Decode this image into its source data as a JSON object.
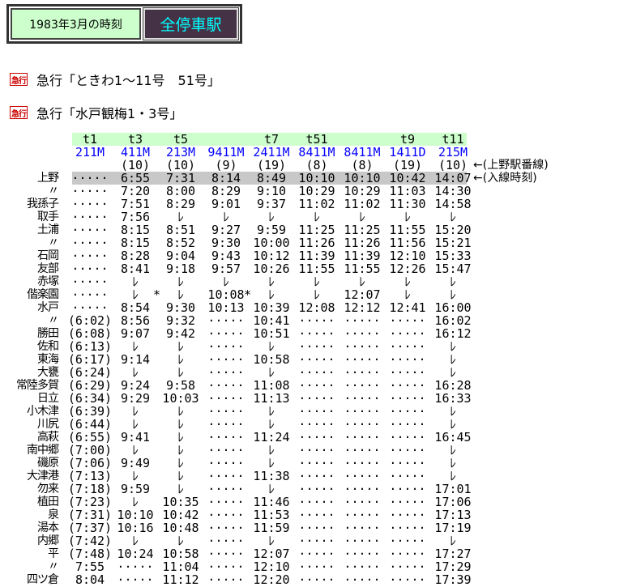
{
  "header": {
    "period": "1983年3月の時刻",
    "mode": "全停車駅"
  },
  "trains": [
    {
      "badge": "急行",
      "name": "急行「ときわ1～11号　51号」"
    },
    {
      "badge": "急行",
      "name": "急行「水戸観梅1・3号」"
    }
  ],
  "table": {
    "trip_codes": [
      "t1",
      "t3",
      "t5",
      "",
      "t7",
      "t51",
      "",
      "t9",
      "t11"
    ],
    "train_numbers": [
      "211M",
      "411M",
      "213M",
      "9411M",
      "2411M",
      "8411M",
      "8411M",
      "1411D",
      "215M"
    ],
    "platforms": [
      "",
      "(10)",
      "(10)",
      "(9)",
      "(19)",
      "(8)",
      "(8)",
      "(19)",
      "(10)"
    ],
    "platform_note": "←(上野駅番線)",
    "entry_note": "←(入線時刻)",
    "rows": [
      {
        "station": "上野",
        "times": [
          "·····",
          "6:55",
          "7:31",
          "8:14",
          "8:49",
          "10:10",
          "10:10",
          "10:42",
          "14:07"
        ],
        "highlight": true
      },
      {
        "station": "〃",
        "times": [
          "·····",
          "7:20",
          "8:00",
          "8:29",
          "9:10",
          "10:29",
          "10:29",
          "11:03",
          "14:30"
        ]
      },
      {
        "station": "我孫子",
        "times": [
          "·····",
          "7:51",
          "8:29",
          "9:01",
          "9:37",
          "11:02",
          "11:02",
          "11:30",
          "14:58"
        ]
      },
      {
        "station": "取手",
        "times": [
          "·····",
          "7:56",
          "ﾚ",
          "ﾚ",
          "ﾚ",
          "ﾚ",
          "ﾚ",
          "ﾚ",
          "ﾚ"
        ]
      },
      {
        "station": "土浦",
        "times": [
          "·····",
          "8:15",
          "8:51",
          "9:27",
          "9:59",
          "11:25",
          "11:25",
          "11:55",
          "15:20"
        ]
      },
      {
        "station": "〃",
        "times": [
          "·····",
          "8:15",
          "8:52",
          "9:30",
          "10:00",
          "11:26",
          "11:26",
          "11:56",
          "15:21"
        ]
      },
      {
        "station": "石岡",
        "times": [
          "·····",
          "8:28",
          "9:04",
          "9:43",
          "10:12",
          "11:39",
          "11:39",
          "12:10",
          "15:33"
        ]
      },
      {
        "station": "友部",
        "times": [
          "·····",
          "8:41",
          "9:18",
          "9:57",
          "10:26",
          "11:55",
          "11:55",
          "12:26",
          "15:47"
        ]
      },
      {
        "station": "赤塚",
        "times": [
          "·····",
          "ﾚ",
          "ﾚ",
          "ﾚ",
          "ﾚ",
          "ﾚ",
          "ﾚ",
          "ﾚ",
          "ﾚ"
        ]
      },
      {
        "station": "偕楽園",
        "times": [
          "·····",
          "ﾚ",
          "ﾚ",
          "10:08",
          "ﾚ",
          "ﾚ",
          "12:07",
          "ﾚ",
          "ﾚ"
        ],
        "asterisks": [
          2,
          4
        ],
        "asterisk": "*"
      },
      {
        "station": "水戸",
        "times": [
          "·····",
          "8:54",
          "9:30",
          "10:13",
          "10:39",
          "12:08",
          "12:12",
          "12:41",
          "16:00"
        ]
      },
      {
        "station": "〃",
        "times": [
          "(6:02)",
          "8:56",
          "9:32",
          "·····",
          "10:41",
          "·····",
          "·····",
          "·····",
          "16:02"
        ]
      },
      {
        "station": "勝田",
        "times": [
          "(6:08)",
          "9:07",
          "9:42",
          "·····",
          "10:51",
          "·····",
          "·····",
          "·····",
          "16:12"
        ]
      },
      {
        "station": "佐和",
        "times": [
          "(6:13)",
          "ﾚ",
          "ﾚ",
          "·····",
          "ﾚ",
          "·····",
          "·····",
          "·····",
          "ﾚ"
        ]
      },
      {
        "station": "東海",
        "times": [
          "(6:17)",
          "9:14",
          "ﾚ",
          "·····",
          "10:58",
          "·····",
          "·····",
          "·····",
          "ﾚ"
        ]
      },
      {
        "station": "大甕",
        "times": [
          "(6:24)",
          "ﾚ",
          "ﾚ",
          "·····",
          "ﾚ",
          "·····",
          "·····",
          "·····",
          "ﾚ"
        ]
      },
      {
        "station": "常陸多賀",
        "times": [
          "(6:29)",
          "9:24",
          "9:58",
          "·····",
          "11:08",
          "·····",
          "·····",
          "·····",
          "16:28"
        ]
      },
      {
        "station": "日立",
        "times": [
          "(6:34)",
          "9:29",
          "10:03",
          "·····",
          "11:13",
          "·····",
          "·····",
          "·····",
          "16:33"
        ]
      },
      {
        "station": "小木津",
        "times": [
          "(6:39)",
          "ﾚ",
          "ﾚ",
          "·····",
          "ﾚ",
          "·····",
          "·····",
          "·····",
          "ﾚ"
        ]
      },
      {
        "station": "川尻",
        "times": [
          "(6:44)",
          "ﾚ",
          "ﾚ",
          "·····",
          "ﾚ",
          "·····",
          "·····",
          "·····",
          "ﾚ"
        ]
      },
      {
        "station": "高萩",
        "times": [
          "(6:55)",
          "9:41",
          "ﾚ",
          "·····",
          "11:24",
          "·····",
          "·····",
          "·····",
          "16:45"
        ]
      },
      {
        "station": "南中郷",
        "times": [
          "(7:00)",
          "ﾚ",
          "ﾚ",
          "·····",
          "ﾚ",
          "·····",
          "·····",
          "·····",
          "ﾚ"
        ]
      },
      {
        "station": "磯原",
        "times": [
          "(7:06)",
          "9:49",
          "ﾚ",
          "·····",
          "ﾚ",
          "·····",
          "·····",
          "·····",
          "ﾚ"
        ]
      },
      {
        "station": "大津港",
        "times": [
          "(7:13)",
          "ﾚ",
          "ﾚ",
          "·····",
          "11:38",
          "·····",
          "·····",
          "·····",
          "ﾚ"
        ]
      },
      {
        "station": "勿来",
        "times": [
          "(7:18)",
          "9:59",
          "ﾚ",
          "·····",
          "ﾚ",
          "·····",
          "·····",
          "·····",
          "17:01"
        ]
      },
      {
        "station": "植田",
        "times": [
          "(7:23)",
          "ﾚ",
          "10:35",
          "·····",
          "11:46",
          "·····",
          "·····",
          "·····",
          "17:06"
        ]
      },
      {
        "station": "泉",
        "times": [
          "(7:31)",
          "10:10",
          "10:42",
          "·····",
          "11:53",
          "·····",
          "·····",
          "·····",
          "17:13"
        ]
      },
      {
        "station": "湯本",
        "times": [
          "(7:37)",
          "10:16",
          "10:48",
          "·····",
          "11:59",
          "·····",
          "·····",
          "·····",
          "17:19"
        ]
      },
      {
        "station": "内郷",
        "times": [
          "(7:42)",
          "ﾚ",
          "ﾚ",
          "·····",
          "ﾚ",
          "·····",
          "·····",
          "·····",
          "ﾚ"
        ]
      },
      {
        "station": "平",
        "times": [
          "(7:48)",
          "10:24",
          "10:58",
          "·····",
          "12:07",
          "·····",
          "·····",
          "·····",
          "17:27"
        ]
      },
      {
        "station": "〃",
        "times": [
          "7:55",
          "·····",
          "11:04",
          "·····",
          "12:10",
          "·····",
          "·····",
          "·····",
          "17:29"
        ]
      },
      {
        "station": "四ツ倉",
        "times": [
          "8:04",
          "·····",
          "11:12",
          "·····",
          "12:20",
          "·····",
          "·····",
          "·····",
          "17:39"
        ]
      }
    ]
  }
}
